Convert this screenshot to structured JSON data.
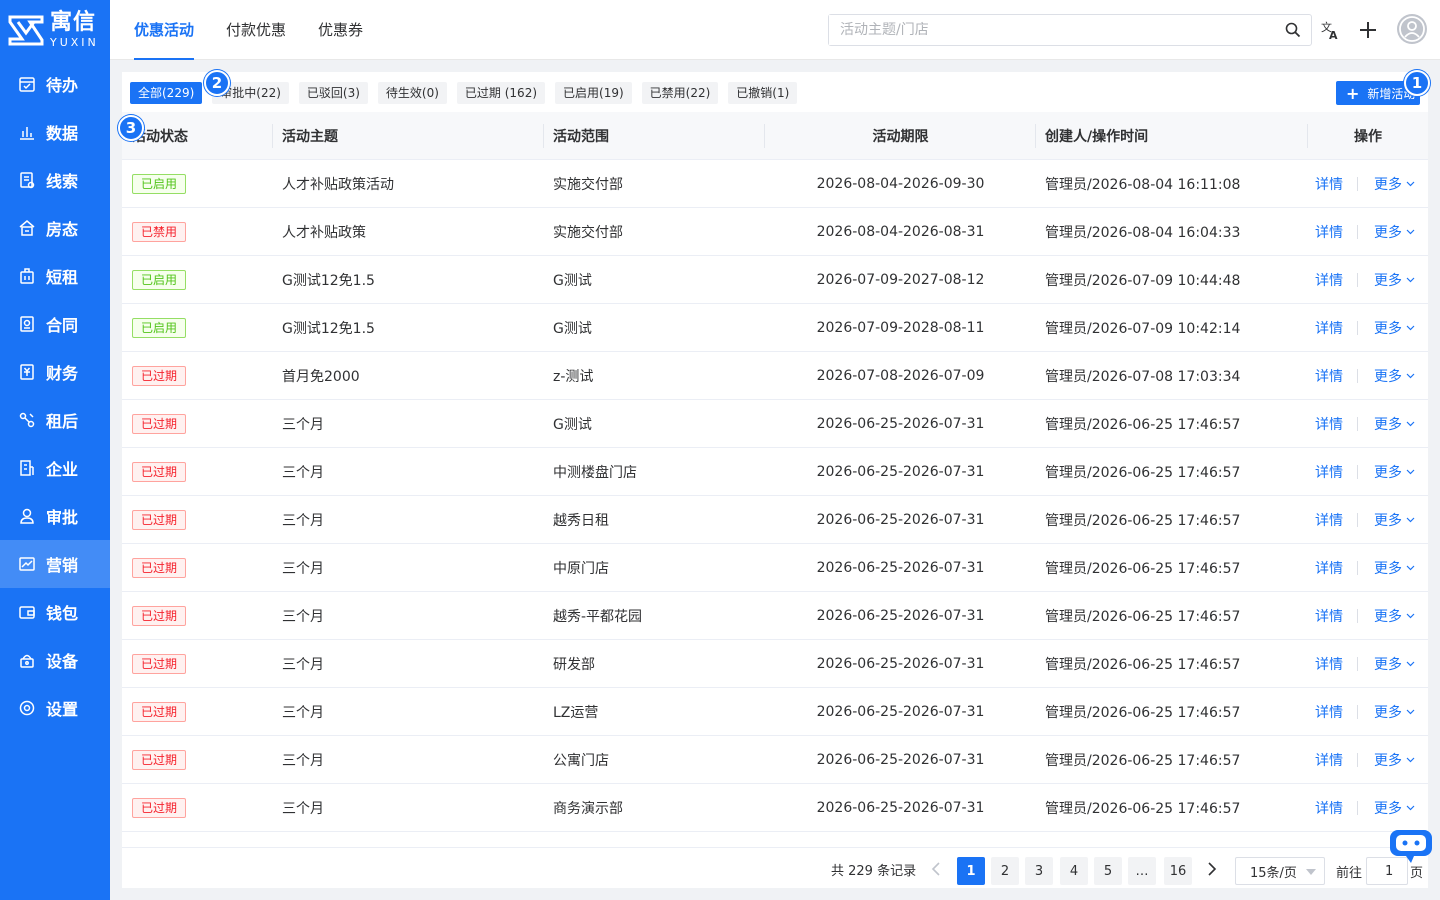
{
  "brand": {
    "cn": "寓信",
    "en": "YUXIN"
  },
  "sidebar": {
    "items": [
      {
        "label": "待办",
        "icon": "calendar-check-icon"
      },
      {
        "label": "数据",
        "icon": "bar-chart-icon"
      },
      {
        "label": "线索",
        "icon": "clue-icon"
      },
      {
        "label": "房态",
        "icon": "house-icon"
      },
      {
        "label": "短租",
        "icon": "suitcase-icon"
      },
      {
        "label": "合同",
        "icon": "contract-icon"
      },
      {
        "label": "财务",
        "icon": "finance-icon"
      },
      {
        "label": "租后",
        "icon": "tools-icon"
      },
      {
        "label": "企业",
        "icon": "building-icon"
      },
      {
        "label": "审批",
        "icon": "approver-icon"
      },
      {
        "label": "营销",
        "icon": "marketing-icon",
        "active": true
      },
      {
        "label": "钱包",
        "icon": "wallet-icon"
      },
      {
        "label": "设备",
        "icon": "device-icon"
      },
      {
        "label": "设置",
        "icon": "settings-icon"
      }
    ]
  },
  "header": {
    "tabs": [
      {
        "label": "优惠活动",
        "active": true
      },
      {
        "label": "付款优惠"
      },
      {
        "label": "优惠券"
      }
    ],
    "search": {
      "placeholder": "活动主题/门店",
      "value": ""
    }
  },
  "filters": [
    {
      "label": "全部(229)",
      "active": true
    },
    {
      "label": "审批中(22)"
    },
    {
      "label": "已驳回(3)"
    },
    {
      "label": "待生效(0)"
    },
    {
      "label": "已过期 (162)"
    },
    {
      "label": "已启用(19)"
    },
    {
      "label": "已禁用(22)"
    },
    {
      "label": "已撤销(1)"
    }
  ],
  "add_button": {
    "label": "新增活动"
  },
  "markers": {
    "m1": "1",
    "m2": "2",
    "m3": "3"
  },
  "table": {
    "columns": [
      "活动状态",
      "活动主题",
      "活动范围",
      "活动期限",
      "创建人/操作时间",
      "操作"
    ],
    "op_detail": "详情",
    "op_more": "更多",
    "rows": [
      {
        "status": "已启用",
        "kind": "on",
        "theme": "人才补贴政策活动",
        "scope": "实施交付部",
        "period": "2026-08-04-2026-09-30",
        "creator": "管理员/2026-08-04 16:11:08"
      },
      {
        "status": "已禁用",
        "kind": "off",
        "theme": "人才补贴政策",
        "scope": "实施交付部",
        "period": "2026-08-04-2026-08-31",
        "creator": "管理员/2026-08-04 16:04:33"
      },
      {
        "status": "已启用",
        "kind": "on",
        "theme": "G测试12免1.5",
        "scope": "G测试",
        "period": "2026-07-09-2027-08-12",
        "creator": "管理员/2026-07-09 10:44:48"
      },
      {
        "status": "已启用",
        "kind": "on",
        "theme": "G测试12免1.5",
        "scope": "G测试",
        "period": "2026-07-09-2028-08-11",
        "creator": "管理员/2026-07-09 10:42:14"
      },
      {
        "status": "已过期",
        "kind": "off",
        "theme": "首月免2000",
        "scope": "z-测试",
        "period": "2026-07-08-2026-07-09",
        "creator": "管理员/2026-07-08 17:03:34"
      },
      {
        "status": "已过期",
        "kind": "off",
        "theme": "三个月",
        "scope": "G测试",
        "period": "2026-06-25-2026-07-31",
        "creator": "管理员/2026-06-25 17:46:57"
      },
      {
        "status": "已过期",
        "kind": "off",
        "theme": "三个月",
        "scope": "中测楼盘门店",
        "period": "2026-06-25-2026-07-31",
        "creator": "管理员/2026-06-25 17:46:57"
      },
      {
        "status": "已过期",
        "kind": "off",
        "theme": "三个月",
        "scope": "越秀日租",
        "period": "2026-06-25-2026-07-31",
        "creator": "管理员/2026-06-25 17:46:57"
      },
      {
        "status": "已过期",
        "kind": "off",
        "theme": "三个月",
        "scope": "中原门店",
        "period": "2026-06-25-2026-07-31",
        "creator": "管理员/2026-06-25 17:46:57"
      },
      {
        "status": "已过期",
        "kind": "off",
        "theme": "三个月",
        "scope": "越秀-平都花园",
        "period": "2026-06-25-2026-07-31",
        "creator": "管理员/2026-06-25 17:46:57"
      },
      {
        "status": "已过期",
        "kind": "off",
        "theme": "三个月",
        "scope": "研发部",
        "period": "2026-06-25-2026-07-31",
        "creator": "管理员/2026-06-25 17:46:57"
      },
      {
        "status": "已过期",
        "kind": "off",
        "theme": "三个月",
        "scope": "LZ运营",
        "period": "2026-06-25-2026-07-31",
        "creator": "管理员/2026-06-25 17:46:57"
      },
      {
        "status": "已过期",
        "kind": "off",
        "theme": "三个月",
        "scope": "公寓门店",
        "period": "2026-06-25-2026-07-31",
        "creator": "管理员/2026-06-25 17:46:57"
      },
      {
        "status": "已过期",
        "kind": "off",
        "theme": "三个月",
        "scope": "商务演示部",
        "period": "2026-06-25-2026-07-31",
        "creator": "管理员/2026-06-25 17:46:57"
      }
    ]
  },
  "pagination": {
    "total_text": "共 229 条记录",
    "pages": [
      "1",
      "2",
      "3",
      "4",
      "5",
      "…",
      "16"
    ],
    "current": "1",
    "page_size": "15条/页",
    "goto_label": "前往",
    "goto_value": "1",
    "goto_suffix": "页"
  },
  "colors": {
    "primary": "#1a73f5",
    "enabled": "#52c41a",
    "disabled": "#f5222d"
  }
}
